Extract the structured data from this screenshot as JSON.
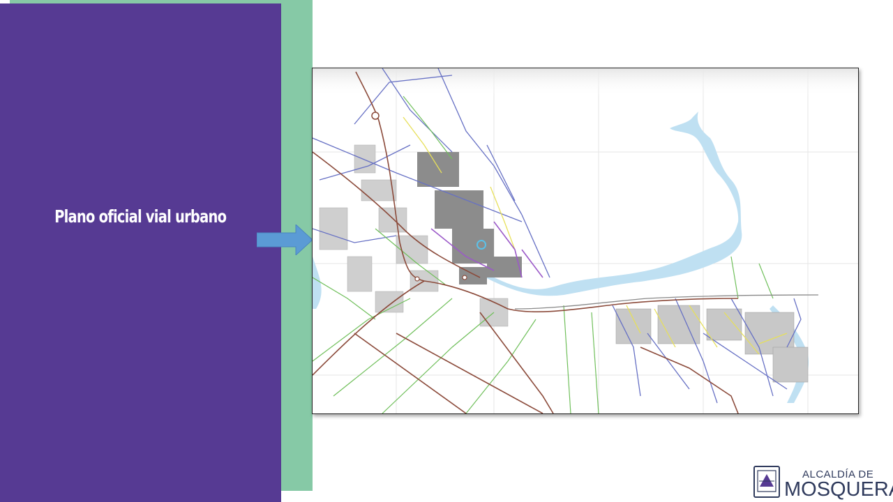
{
  "slide": {
    "title": "Plano oficial  vial urbano"
  },
  "colors": {
    "purple_panel": "#563a93",
    "green_band": "#86c9a6",
    "arrow": "#5b9bd5",
    "water": "#bfe0f2",
    "road_blue": "#6670c4",
    "road_green": "#6fbf5a",
    "road_yellow": "#e7e05a",
    "road_purple": "#9b59c8",
    "road_brown": "#8b4a3a",
    "logo_text": "#2f3a5c"
  },
  "logo": {
    "line1": "ALCALDÍA DE",
    "line2": "MOSQUERA"
  }
}
